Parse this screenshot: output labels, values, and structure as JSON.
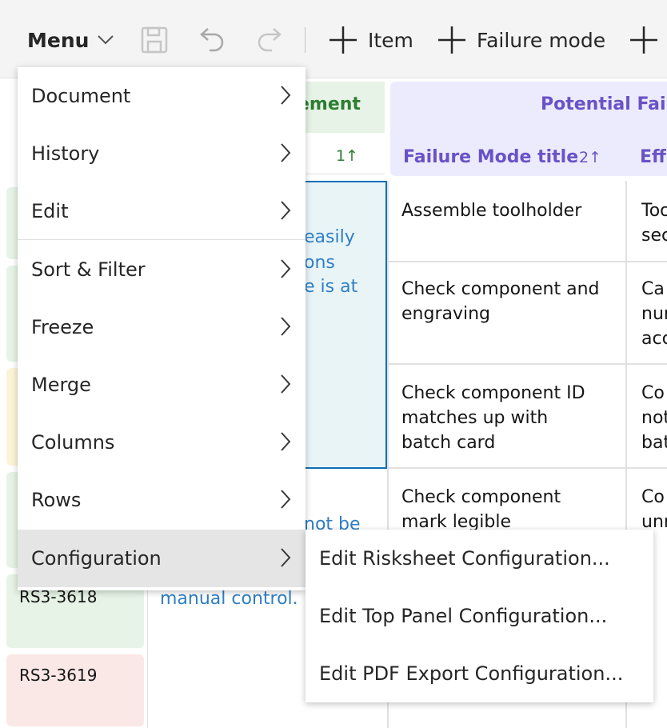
{
  "toolbar": {
    "menu_label": "Menu",
    "add_item_label": "Item",
    "add_failure_mode_label": "Failure mode"
  },
  "grid": {
    "requirement_header": "ement",
    "requirement_sort": "1",
    "potential_failure_header": "Potential Fail",
    "failure_mode_title_header": "Failure Mode title",
    "failure_mode_sort": "2",
    "effect_header": "Eff",
    "ids": [
      "RS3-3618",
      "RS3-3619"
    ],
    "requirement_fragments": [
      "easily",
      "ons",
      "e is at",
      "not be",
      "manual control."
    ],
    "failure_modes": [
      [
        "Assemble toolholder"
      ],
      [
        "Check component and",
        "engraving"
      ],
      [
        "Check component ID",
        "matches up with",
        "batch card"
      ],
      [
        "Check component",
        "mark legible"
      ]
    ],
    "effects": [
      [
        "Too",
        "sec"
      ],
      [
        "Ca",
        "nur",
        "acc"
      ],
      [
        "Co",
        "not",
        "bat"
      ],
      [
        "Co",
        "unr"
      ]
    ]
  },
  "menu": {
    "items": [
      {
        "label": "Document"
      },
      {
        "label": "History"
      },
      {
        "label": "Edit"
      },
      {
        "label": "Sort & Filter"
      },
      {
        "label": "Freeze"
      },
      {
        "label": "Merge"
      },
      {
        "label": "Columns"
      },
      {
        "label": "Rows"
      },
      {
        "label": "Configuration"
      }
    ]
  },
  "submenu": {
    "items": [
      {
        "label": "Edit Risksheet Configuration..."
      },
      {
        "label": "Edit Top Panel Configuration..."
      },
      {
        "label": "Edit PDF Export Configuration..."
      }
    ]
  },
  "colors": {
    "accent_blue": "#0f6fb8",
    "requirement_green": "#2e7d32",
    "failure_purple": "#6a52c6",
    "link_blue": "#2f7fc4"
  }
}
